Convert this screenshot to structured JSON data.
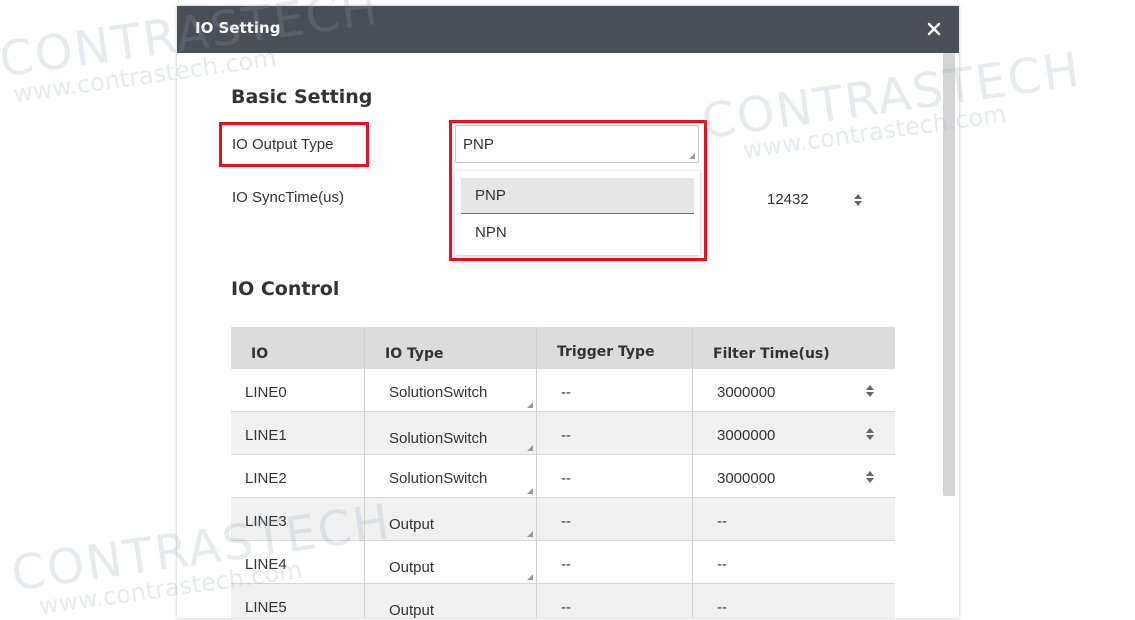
{
  "dialog": {
    "title": "IO Setting"
  },
  "basic_setting": {
    "heading": "Basic Setting",
    "io_output_type": {
      "label": "IO Output Type",
      "value": "PNP",
      "options": [
        "PNP",
        "NPN"
      ],
      "selected_option": "PNP"
    },
    "io_sync_time": {
      "label": "IO SyncTime(us)",
      "value": "12432"
    }
  },
  "io_control": {
    "heading": "IO Control",
    "columns": [
      "IO",
      "IO Type",
      "Trigger Type",
      "Filter Time(us)"
    ],
    "rows": [
      {
        "io": "LINE0",
        "type": "SolutionSwitch",
        "trigger": "--",
        "filter": "3000000"
      },
      {
        "io": "LINE1",
        "type": "SolutionSwitch",
        "trigger": "--",
        "filter": "3000000"
      },
      {
        "io": "LINE2",
        "type": "SolutionSwitch",
        "trigger": "--",
        "filter": "3000000"
      },
      {
        "io": "LINE3",
        "type": "Output",
        "trigger": "--",
        "filter": "--"
      },
      {
        "io": "LINE4",
        "type": "Output",
        "trigger": "--",
        "filter": "--"
      },
      {
        "io": "LINE5",
        "type": "Output",
        "trigger": "--",
        "filter": "--"
      }
    ]
  },
  "watermark": {
    "brand": "CONTRASTECH",
    "url": "www.contrastech.com"
  },
  "icons": {
    "close": "close-icon",
    "spin": "spin-arrows-icon",
    "resize": "dropdown-corner-icon"
  },
  "colors": {
    "titlebar": "#4a4f57",
    "highlight_box": "#e0141c",
    "header_row": "#dcdcdc",
    "selected_underline": "#3f72c9"
  }
}
